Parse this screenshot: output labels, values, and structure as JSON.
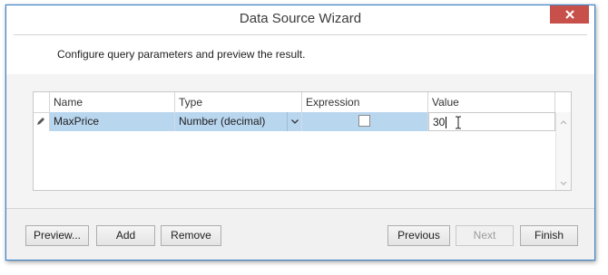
{
  "window": {
    "title": "Data Source Wizard"
  },
  "header": {
    "text": "Configure query parameters and preview the result."
  },
  "grid": {
    "columns": [
      "Name",
      "Type",
      "Expression",
      "Value"
    ],
    "rows": [
      {
        "name": "MaxPrice",
        "type": "Number (decimal)",
        "expression": false,
        "value": "30"
      }
    ]
  },
  "buttons": {
    "preview": "Preview...",
    "add": "Add",
    "remove": "Remove",
    "previous": "Previous",
    "next": "Next",
    "finish": "Finish"
  },
  "colors": {
    "close_button": "#c7504b",
    "selected_row": "#b9d6ef",
    "window_border": "#3c83c9"
  },
  "icons": {
    "close": "close-icon",
    "row_edit": "pencil-icon",
    "type_dropdown": "chevron-down-icon",
    "scroll_up": "scroll-up-icon",
    "scroll_down": "scroll-down-icon",
    "cursor": "text-cursor-icon"
  }
}
